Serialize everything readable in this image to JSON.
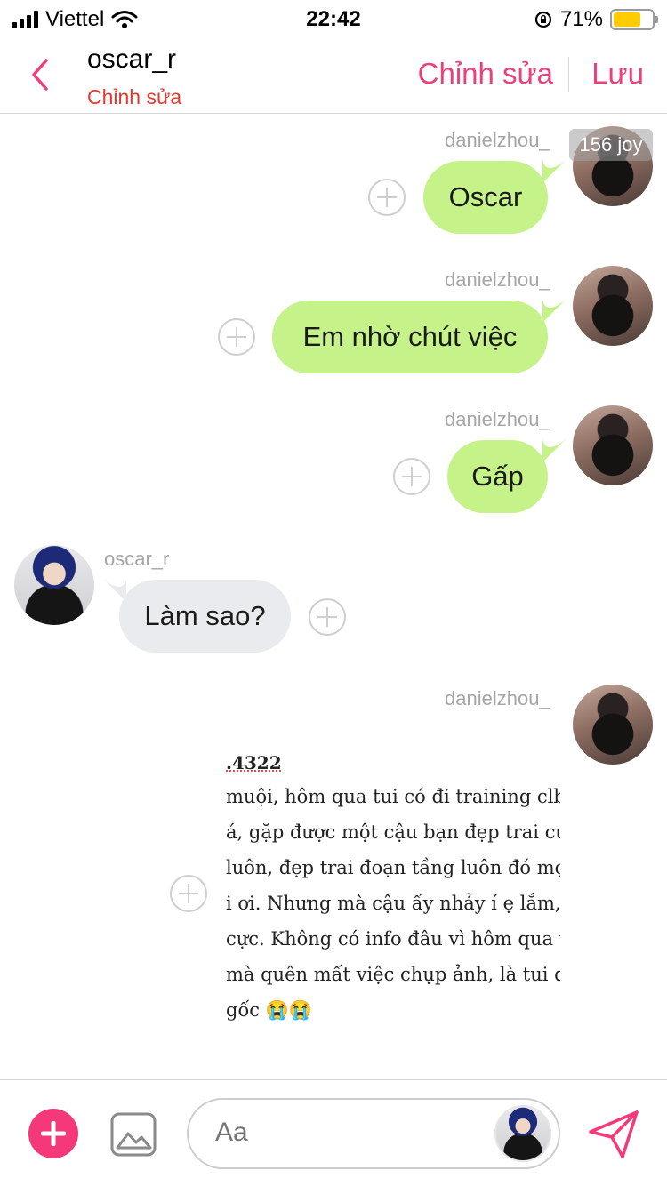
{
  "status_bar": {
    "carrier": "Viettel",
    "time": "22:42",
    "battery": "71%",
    "battery_level": 0.71
  },
  "header": {
    "name": "oscar_r",
    "subtitle": "Chỉnh sửa",
    "edit_label": "Chỉnh sửa",
    "save_label": "Lưu"
  },
  "badge": "156 joy",
  "messages": [
    {
      "sender": "danielzhou_",
      "text": "Oscar"
    },
    {
      "sender": "danielzhou_",
      "text": "Em nhờ chút việc"
    },
    {
      "sender": "danielzhou_",
      "text": "Gấp"
    },
    {
      "sender": "oscar_r",
      "text": "Làm sao?"
    },
    {
      "sender": "danielzhou_",
      "image_lines": [
        ".4322",
        "muội, hôm qua tui có đi training clb",
        "á, gặp được một cậu bạn đẹp trai cực",
        "luôn, đẹp trai đoạn tầng luôn đó mọ",
        "i ơi. Nhưng mà cậu ấy nhảy í ẹ lắm, l",
        "cực. Không có info đâu vì hôm qua tu",
        "mà quên mất việc chụp ảnh, là tui q",
        "gốc 😭😭"
      ]
    }
  ],
  "composer": {
    "placeholder": "Aa"
  },
  "icons": {
    "back": "chevron-left-icon",
    "add": "plus-icon",
    "gallery": "image-icon",
    "send": "send-icon"
  },
  "colors": {
    "accent": "#ee3f7d",
    "subtitle": "#e8372b",
    "outgoing_bubble": "#c6f28a",
    "incoming_bubble": "#e9ebee"
  }
}
